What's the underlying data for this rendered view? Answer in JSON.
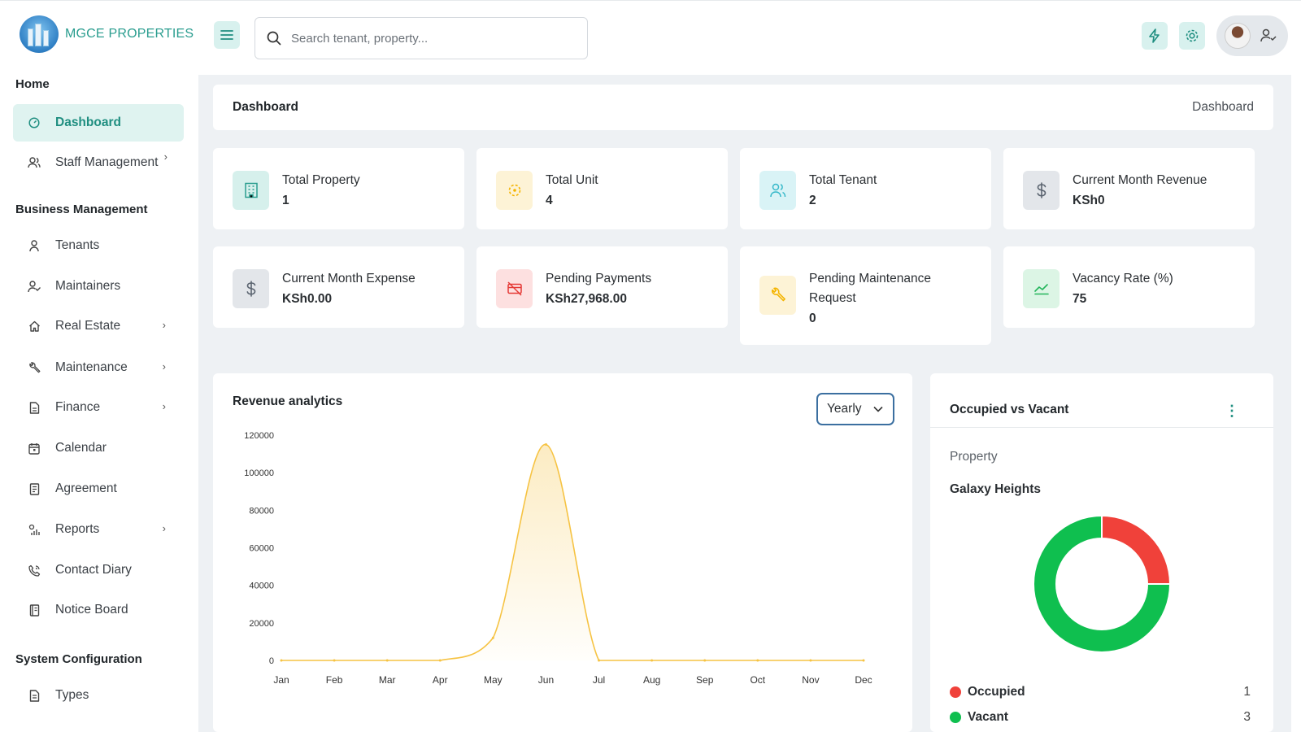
{
  "brand": {
    "name": "MGCE PROPERTIES"
  },
  "search": {
    "placeholder": "Search tenant, property..."
  },
  "sidebar": {
    "sections": [
      {
        "title": "Home"
      },
      {
        "title": "Business Management"
      },
      {
        "title": "System Configuration"
      }
    ],
    "items": [
      {
        "label": "Dashboard",
        "icon": "dashboard-icon",
        "active": true
      },
      {
        "label": "Staff Management",
        "icon": "users-icon",
        "chevron": true
      },
      {
        "label": "Tenants",
        "icon": "user-icon"
      },
      {
        "label": "Maintainers",
        "icon": "user-check-icon"
      },
      {
        "label": "Real Estate",
        "icon": "home-icon",
        "chevron": true
      },
      {
        "label": "Maintenance",
        "icon": "wrench-icon",
        "chevron": true
      },
      {
        "label": "Finance",
        "icon": "file-icon",
        "chevron": true
      },
      {
        "label": "Calendar",
        "icon": "calendar-icon"
      },
      {
        "label": "Agreement",
        "icon": "agreement-icon"
      },
      {
        "label": "Reports",
        "icon": "reports-icon",
        "chevron": true
      },
      {
        "label": "Contact Diary",
        "icon": "phone-icon"
      },
      {
        "label": "Notice Board",
        "icon": "notice-icon"
      },
      {
        "label": "Types",
        "icon": "types-icon"
      }
    ]
  },
  "breadcrumb": {
    "title": "Dashboard",
    "current": "Dashboard"
  },
  "stats": [
    {
      "label": "Total Property",
      "value": "1",
      "icon": "building-icon",
      "color": "#2a9d8f",
      "bg": "#d6f0ec"
    },
    {
      "label": "Total Unit",
      "value": "4",
      "icon": "units-icon",
      "color": "#f4b400",
      "bg": "#fdf3d6"
    },
    {
      "label": "Total Tenant",
      "value": "2",
      "icon": "tenants-icon",
      "color": "#35b8c9",
      "bg": "#d9f3f6"
    },
    {
      "label": "Current Month Revenue",
      "value": "KSh0",
      "icon": "dollar-icon",
      "color": "#5b6470",
      "bg": "#e3e6ea"
    },
    {
      "label": "Current Month Expense",
      "value": "KSh0.00",
      "icon": "dollar-icon",
      "color": "#5b6470",
      "bg": "#e3e6ea"
    },
    {
      "label": "Pending Payments",
      "value": "KSh27,968.00",
      "icon": "no-card-icon",
      "color": "#e53935",
      "bg": "#fde0e0"
    },
    {
      "label": "Pending Maintenance Request",
      "value": "0",
      "icon": "wrench-icon",
      "color": "#f4b400",
      "bg": "#fdf3d6"
    },
    {
      "label": "Vacancy Rate (%)",
      "value": "75",
      "icon": "trend-icon",
      "color": "#22b55b",
      "bg": "#dcf5e5"
    }
  ],
  "revenue": {
    "title": "Revenue analytics",
    "period": "Yearly"
  },
  "occupancy": {
    "title": "Occupied vs Vacant",
    "subtitle": "Property",
    "property": "Galaxy Heights",
    "legend": [
      {
        "name": "Occupied",
        "count": "1",
        "color": "#f0413a"
      },
      {
        "name": "Vacant",
        "count": "3",
        "color": "#0fbf4f"
      }
    ]
  },
  "chart_data": {
    "type": "area",
    "title": "Revenue analytics",
    "categories": [
      "Jan",
      "Feb",
      "Mar",
      "Apr",
      "May",
      "Jun",
      "Jul",
      "Aug",
      "Sep",
      "Oct",
      "Nov",
      "Dec"
    ],
    "series": [
      {
        "values": [
          0,
          0,
          0,
          0,
          12000,
          115000,
          0,
          0,
          0,
          0,
          0,
          0
        ],
        "color": "#f6c343"
      }
    ],
    "yticks": [
      "120000",
      "100000",
      "80000",
      "60000",
      "40000",
      "20000",
      "0"
    ],
    "ylim": [
      0,
      120000
    ],
    "grid": false
  },
  "donut_data": {
    "type": "pie",
    "values": [
      1,
      3
    ],
    "labels": [
      "Occupied",
      "Vacant"
    ],
    "colors": [
      "#f0413a",
      "#0fbf4f"
    ]
  }
}
